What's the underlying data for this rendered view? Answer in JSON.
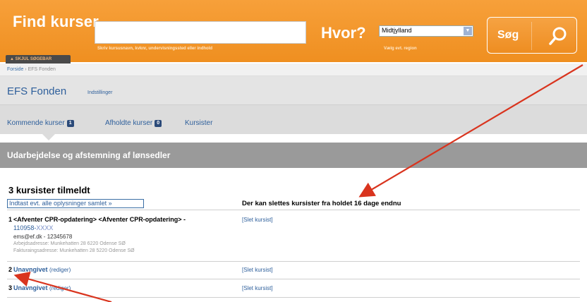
{
  "search": {
    "title": "Find kurser",
    "input_value": "",
    "hint": "Skriv kursusnavn, kvknr, undervisningssted eller indhold",
    "where_label": "Hvor?",
    "region_value": "Midtjylland",
    "region_hint": "Vælg evt. region",
    "button_label": "Søg",
    "collapse_label": "SKJUL SØGEBAR"
  },
  "breadcrumb": {
    "home": "Forside",
    "separator": "›",
    "current": "EFS Fonden"
  },
  "org": {
    "name": "EFS Fonden",
    "settings_link": "Indstillinger"
  },
  "tabs": [
    {
      "label": "Kommende kurser",
      "count": "1"
    },
    {
      "label": "Afholdte kurser",
      "count": "0"
    },
    {
      "label": "Kursister",
      "count": ""
    }
  ],
  "course": {
    "title": "Udarbejdelse og afstemning af lønsedler"
  },
  "participants": {
    "heading": "3 kursister tilmeldt",
    "enter_all_link": "Indtast evt. alle oplysninger samlet »",
    "deadline_note": "Der kan slettes kursister fra holdet 16 dage endnu",
    "rows": [
      {
        "index": "1",
        "name": "<Afventer CPR-opdatering> <Afventer CPR-opdatering> -",
        "cpr_prefix": "110958-",
        "cpr_mask": "XXXX",
        "contact": "ems@ef.dk - 12345678",
        "work_address": "Arbejdsadresse: Munkehatten 28 6220 Odense SØ",
        "billing_address": "Fakturaingsadresse: Munkehatten 28 5220 Odense SØ",
        "delete_label": "[Slet kursist]"
      },
      {
        "index": "2",
        "name": "Unavngivet",
        "edit_label": "(rediger)",
        "delete_label": "[Slet kursist]"
      },
      {
        "index": "3",
        "name": "Unavngivet",
        "edit_label": "(rediger)",
        "delete_label": "[Slet kursist]"
      }
    ]
  },
  "colors": {
    "header_orange": "#ef8f20",
    "link_blue": "#2e5f9b",
    "badge_navy": "#2b4a79",
    "course_bar_gray": "#9a9a9a",
    "annotation_red": "#d9341e"
  }
}
